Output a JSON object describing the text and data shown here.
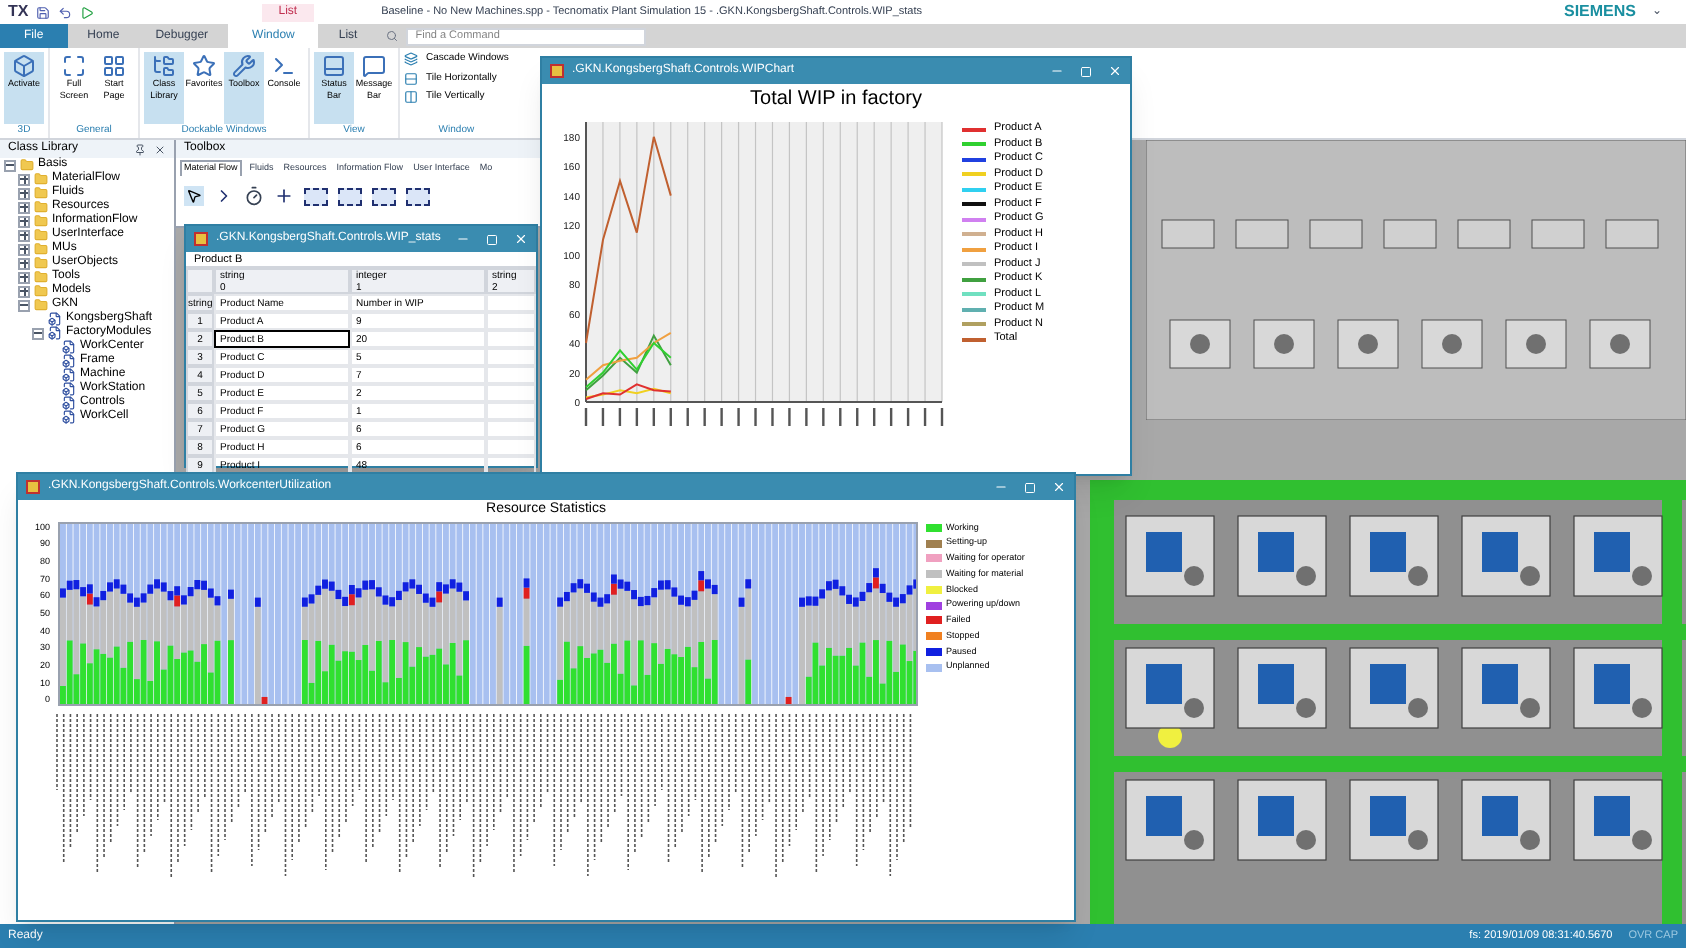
{
  "app": {
    "logo": "TX",
    "context_tab": "List",
    "title": "Baseline - No New Machines.spp - Tecnomatix Plant Simulation 15 - .GKN.KongsbergShaft.Controls.WIP_stats",
    "brand": "SIEMENS",
    "brand_caret": "⌄"
  },
  "ribbon_tabs": [
    {
      "label": "File",
      "selected": false,
      "kind": "file"
    },
    {
      "label": "Home",
      "selected": false,
      "kind": "tab"
    },
    {
      "label": "Debugger",
      "selected": false,
      "kind": "tab"
    },
    {
      "label": "Window",
      "selected": true,
      "kind": "tab"
    },
    {
      "label": "List",
      "selected": false,
      "kind": "tab"
    }
  ],
  "search": {
    "placeholder": "Find a Command"
  },
  "ribbon_groups": [
    {
      "name": "3D",
      "buttons": [
        {
          "label": "Activate",
          "on": true
        }
      ]
    },
    {
      "name": "General",
      "buttons": [
        {
          "label": "Full Screen",
          "on": false
        },
        {
          "label": "Start Page",
          "on": false
        }
      ]
    },
    {
      "name": "Dockable Windows",
      "buttons": [
        {
          "label": "Class Library",
          "on": true
        },
        {
          "label": "Favorites",
          "on": false
        },
        {
          "label": "Toolbox",
          "on": true
        },
        {
          "label": "Console",
          "on": false
        }
      ]
    },
    {
      "name": "View",
      "buttons": [
        {
          "label": "Status Bar",
          "on": true
        },
        {
          "label": "Message Bar",
          "on": false
        }
      ]
    }
  ],
  "window_group": {
    "name": "Window",
    "commands": [
      "Cascade Windows",
      "Tile Horizontally",
      "Tile Vertically"
    ]
  },
  "class_library": {
    "title": "Class Library",
    "tree": [
      {
        "label": "Basis",
        "expanded": true,
        "children": [
          {
            "label": "MaterialFlow",
            "expanded": false
          },
          {
            "label": "Fluids",
            "expanded": false
          },
          {
            "label": "Resources",
            "expanded": false
          },
          {
            "label": "InformationFlow",
            "expanded": false
          },
          {
            "label": "UserInterface",
            "expanded": false
          },
          {
            "label": "MUs",
            "expanded": false
          },
          {
            "label": "UserObjects",
            "expanded": false
          },
          {
            "label": "Tools",
            "expanded": false
          },
          {
            "label": "Models",
            "expanded": false
          },
          {
            "label": "GKN",
            "expanded": true,
            "children": [
              {
                "label": "KongsbergShaft"
              },
              {
                "label": "FactoryModules",
                "expanded": true,
                "children": [
                  {
                    "label": "WorkCenter"
                  },
                  {
                    "label": "Frame"
                  },
                  {
                    "label": "Machine"
                  },
                  {
                    "label": "WorkStation"
                  },
                  {
                    "label": "Controls"
                  },
                  {
                    "label": "WorkCell"
                  }
                ]
              }
            ]
          }
        ]
      }
    ]
  },
  "toolbox": {
    "title": "Toolbox",
    "tabs": [
      {
        "label": "Material Flow",
        "selected": true
      },
      {
        "label": "Fluids",
        "selected": false
      },
      {
        "label": "Resources",
        "selected": false
      },
      {
        "label": "Information Flow",
        "selected": false
      },
      {
        "label": "User Interface",
        "selected": false
      },
      {
        "label": "Mo",
        "selected": false
      }
    ]
  },
  "table_window": {
    "title": ".GKN.KongsbergShaft.Controls.WIP_stats",
    "cell_value": "Product B",
    "columns": [
      {
        "type": "string",
        "index": "0"
      },
      {
        "type": "integer",
        "index": "1"
      },
      {
        "type": "string",
        "index": "2"
      }
    ],
    "header_row": {
      "label": "string",
      "cells": [
        "Product Name",
        "Number in WIP"
      ]
    },
    "rows": [
      {
        "index": "1",
        "name": "Product A",
        "value": "9",
        "selected": false
      },
      {
        "index": "2",
        "name": "Product B",
        "value": "20",
        "selected": true
      },
      {
        "index": "3",
        "name": "Product C",
        "value": "5",
        "selected": false
      },
      {
        "index": "4",
        "name": "Product D",
        "value": "7",
        "selected": false
      },
      {
        "index": "5",
        "name": "Product E",
        "value": "2",
        "selected": false
      },
      {
        "index": "6",
        "name": "Product F",
        "value": "1",
        "selected": false
      },
      {
        "index": "7",
        "name": "Product G",
        "value": "6",
        "selected": false
      },
      {
        "index": "8",
        "name": "Product H",
        "value": "6",
        "selected": false
      },
      {
        "index": "9",
        "name": "Product I",
        "value": "48",
        "selected": false
      }
    ]
  },
  "chart_window": {
    "title": ".GKN.KongsbergShaft.Controls.WIPChart",
    "chart_data": {
      "type": "line",
      "title": "Total WIP in factory",
      "categories": [
        null,
        null,
        null,
        null,
        null,
        null,
        null,
        null,
        null,
        null,
        null,
        null,
        null,
        null,
        null,
        null,
        null,
        null,
        null,
        null,
        null,
        null
      ],
      "ylim": [
        0,
        190
      ],
      "grid": true,
      "yticks": [
        0,
        20,
        40,
        60,
        80,
        100,
        120,
        140,
        160,
        180
      ],
      "series": [
        {
          "name": "Product A",
          "color": "#e03030",
          "values": [
            2,
            6,
            5,
            12,
            8,
            7,
            null,
            null,
            null,
            null,
            null,
            null,
            null,
            null,
            null,
            null,
            null,
            null,
            null,
            null,
            null,
            null
          ]
        },
        {
          "name": "Product B",
          "color": "#30d030",
          "values": [
            10,
            20,
            35,
            22,
            40,
            30,
            null,
            null,
            null,
            null,
            null,
            null,
            null,
            null,
            null,
            null,
            null,
            null,
            null,
            null,
            null,
            null
          ]
        },
        {
          "name": "Product C",
          "color": "#2040e0",
          "values": [
            null,
            null,
            null,
            null,
            null,
            null,
            null,
            null,
            null,
            null,
            null,
            null,
            null,
            null,
            null,
            null,
            null,
            null,
            null,
            null,
            null,
            null
          ]
        },
        {
          "name": "Product D",
          "color": "#f0d020",
          "values": [
            3,
            5,
            8,
            6,
            9,
            6,
            null,
            null,
            null,
            null,
            null,
            null,
            null,
            null,
            null,
            null,
            null,
            null,
            null,
            null,
            null,
            null
          ]
        },
        {
          "name": "Product E",
          "color": "#30d0f0",
          "values": [
            null,
            null,
            null,
            null,
            null,
            null,
            null,
            null,
            null,
            null,
            null,
            null,
            null,
            null,
            null,
            null,
            null,
            null,
            null,
            null,
            null,
            null
          ]
        },
        {
          "name": "Product F",
          "color": "#101010",
          "values": [
            null,
            null,
            null,
            null,
            null,
            null,
            null,
            null,
            null,
            null,
            null,
            null,
            null,
            null,
            null,
            null,
            null,
            null,
            null,
            null,
            null,
            null
          ]
        },
        {
          "name": "Product G",
          "color": "#d080f0",
          "values": [
            null,
            null,
            null,
            null,
            null,
            null,
            null,
            null,
            null,
            null,
            null,
            null,
            null,
            null,
            null,
            null,
            null,
            null,
            null,
            null,
            null,
            null
          ]
        },
        {
          "name": "Product H",
          "color": "#d0b090",
          "values": [
            null,
            null,
            null,
            null,
            null,
            null,
            null,
            null,
            null,
            null,
            null,
            null,
            null,
            null,
            null,
            null,
            null,
            null,
            null,
            null,
            null,
            null
          ]
        },
        {
          "name": "Product I",
          "color": "#f0a040",
          "values": [
            15,
            25,
            28,
            30,
            40,
            47,
            null,
            null,
            null,
            null,
            null,
            null,
            null,
            null,
            null,
            null,
            null,
            null,
            null,
            null,
            null,
            null
          ]
        },
        {
          "name": "Product J",
          "color": "#c0c0c0",
          "values": [
            null,
            null,
            null,
            null,
            null,
            null,
            null,
            null,
            null,
            null,
            null,
            null,
            null,
            null,
            null,
            null,
            null,
            null,
            null,
            null,
            null,
            null
          ]
        },
        {
          "name": "Product K",
          "color": "#40a040",
          "values": [
            8,
            18,
            30,
            20,
            45,
            25,
            null,
            null,
            null,
            null,
            null,
            null,
            null,
            null,
            null,
            null,
            null,
            null,
            null,
            null,
            null,
            null
          ]
        },
        {
          "name": "Product L",
          "color": "#70e0c0",
          "values": [
            null,
            null,
            null,
            null,
            null,
            null,
            null,
            null,
            null,
            null,
            null,
            null,
            null,
            null,
            null,
            null,
            null,
            null,
            null,
            null,
            null,
            null
          ]
        },
        {
          "name": "Product M",
          "color": "#60b0b0",
          "values": [
            null,
            null,
            null,
            null,
            null,
            null,
            null,
            null,
            null,
            null,
            null,
            null,
            null,
            null,
            null,
            null,
            null,
            null,
            null,
            null,
            null,
            null
          ]
        },
        {
          "name": "Product N",
          "color": "#b0a060",
          "values": [
            null,
            null,
            null,
            null,
            null,
            null,
            null,
            null,
            null,
            null,
            null,
            null,
            null,
            null,
            null,
            null,
            null,
            null,
            null,
            null,
            null,
            null
          ]
        },
        {
          "name": "Total",
          "color": "#c06030",
          "values": [
            40,
            110,
            150,
            115,
            180,
            140,
            null,
            null,
            null,
            null,
            null,
            null,
            null,
            null,
            null,
            null,
            null,
            null,
            null,
            null,
            null,
            null
          ]
        }
      ]
    }
  },
  "stats_window": {
    "title": ".GKN.KongsbergShaft.Controls.WorkcenterUtilization",
    "chart_title": "Resource Statistics",
    "yticks": [
      "100",
      "90",
      "80",
      "70",
      "60",
      "50",
      "40",
      "30",
      "20",
      "10",
      "0"
    ],
    "legend": [
      {
        "label": "Working",
        "color": "#30e030"
      },
      {
        "label": "Setting-up",
        "color": "#a08050"
      },
      {
        "label": "Waiting for operator",
        "color": "#f0a0c0"
      },
      {
        "label": "Waiting for material",
        "color": "#c0c0c0"
      },
      {
        "label": "Blocked",
        "color": "#f0f040"
      },
      {
        "label": "Powering up/down",
        "color": "#a040e0"
      },
      {
        "label": "Failed",
        "color": "#e02020"
      },
      {
        "label": "Stopped",
        "color": "#f08020"
      },
      {
        "label": "Paused",
        "color": "#1020e0"
      },
      {
        "label": "Unplanned",
        "color": "#a8c0f0"
      }
    ]
  },
  "status_bar": {
    "left": "Ready",
    "time": "fs: 2019/01/09 08:31:40.5670",
    "flags": "OVR CAP"
  }
}
